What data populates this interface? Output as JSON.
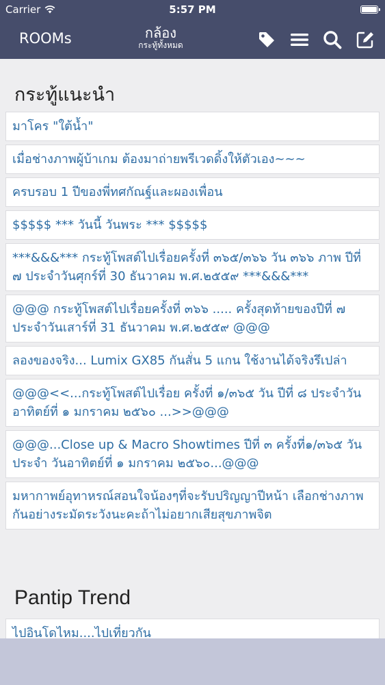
{
  "status": {
    "carrier": "Carrier",
    "time": "5:57 PM"
  },
  "nav": {
    "left_label": "ROOMs",
    "title": "กล้อง",
    "subtitle": "กระทู้ทั้งหมด",
    "icons": [
      "tag-icon",
      "menu-icon",
      "search-icon",
      "compose-icon"
    ]
  },
  "sections": [
    {
      "title": "กระทู้แนะนำ",
      "items": [
        "มาโคร \"ใต้น้ำ\"",
        "เมื่อช่างภาพผู้บ้าเกม ต้องมาถ่ายพรีเวดดิ้งให้ตัวเอง~~~",
        "ครบรอบ 1 ปีของพี่ทศกัณฐ์และผองเพื่อน",
        "$$$$$ *** วันนี้ วันพระ *** $$$$$",
        "***&&&*** กระทู้โพสต์ไปเรื่อยครั้งที่ ๓๖๕/๓๖๖ วัน ๓๖๖ ภาพ ปีที่ ๗ ประจำวันศุกร์ที่ 30 ธันวาคม พ.ศ.๒๕๕๙ ***&&&***",
        "@@@ กระทู้โพสต์ไปเรื่อยครั้งที่ ๓๖๖ ..... ครั้งสุดท้ายของปีที่ ๗ ประจำวันเสาร์ที่ 31 ธันวาคม พ.ศ.๒๕๕๙ @@@",
        "ลองของจริง... Lumix GX85 กันสั่น 5 แกน ใช้งานได้จริงรึเปล่า",
        "@@@<<...กระทู้โพสต์ไปเรื่อย ครั้งที่ ๑/๓๖๕ วัน ปีที่ ๘ ประจำวันอาทิตย์ที่ ๑ มกราคม ๒๕๖๐ ...>>@@@",
        "@@@...Close up & Macro Showtimes ปีที่ ๓ ครั้งที่๑/๓๖๕ วัน ประจำ วันอาทิตย์ที่ ๑ มกราคม ๒๕๖๐...@@@",
        "มหากาพย์อุทาหรณ์สอนใจน้องๆที่จะรับปริญญาปีหน้า เลือกช่างภาพกันอย่างระมัดระวังนะคะถ้าไม่อยากเสียสุขภาพจิต"
      ]
    },
    {
      "title": "Pantip Trend",
      "items": [
        "ไปอินโดไหม....ไปเที่ยวกัน"
      ]
    }
  ],
  "colors": {
    "nav_bg": "#464d6b",
    "link": "#2e6da4",
    "bottom_bar": "#c3c6d9"
  }
}
